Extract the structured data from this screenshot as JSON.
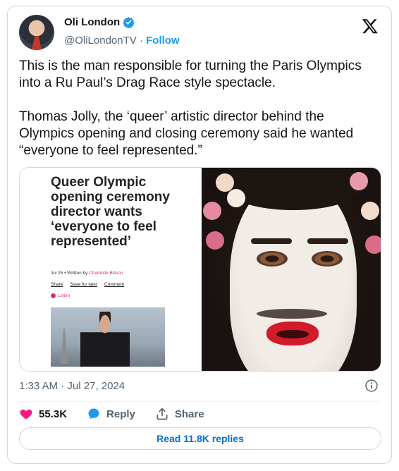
{
  "author": {
    "name": "Oli London",
    "handle": "@OliLondonTV",
    "separator": " · ",
    "follow_label": "Follow",
    "verified_color": "#1d9bf0"
  },
  "tweet": {
    "text": "This is the man responsible for turning  the Paris Olympics into a Ru Paul’s Drag Race style spectacle.\n\nThomas Jolly, the ‘queer’ artistic director behind the Olympics opening and closing ceremony said he wanted “everyone to feel represented.”",
    "timestamp": "1:33 AM · Jul 27, 2024"
  },
  "media": {
    "article": {
      "headline": "Queer Olympic opening ceremony director wants ‘everyone to feel represented’",
      "date": "Jul 25 • Written by ",
      "author": "Chantelle Billson",
      "actions": [
        "Share",
        "Save for later",
        "Comment"
      ],
      "listen_label": "Listen"
    }
  },
  "engagement": {
    "likes": "55.3K",
    "reply_label": "Reply",
    "share_label": "Share",
    "read_replies_label": "Read 11.8K replies"
  },
  "colors": {
    "like": "#f91880",
    "accent": "#1d9bf0",
    "link": "#006fd6",
    "muted": "#536471"
  },
  "icons": {
    "logo": "x-logo-icon",
    "verified": "verified-badge-icon",
    "info": "info-icon",
    "like": "heart-icon",
    "reply": "speech-bubble-icon",
    "share": "share-upload-icon"
  }
}
